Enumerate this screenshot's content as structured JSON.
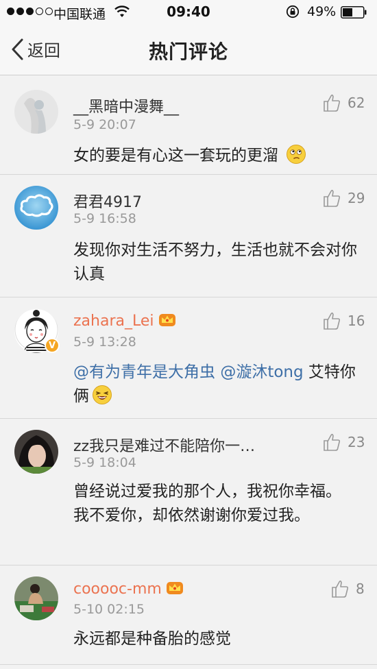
{
  "status_bar": {
    "carrier": "中国联通",
    "time": "09:40",
    "battery_percent": "49%",
    "battery_level": 0.49,
    "signal_bars_filled": 3,
    "signal_bars_total": 5
  },
  "nav": {
    "back_label": "返回",
    "title": "热门评论"
  },
  "colors": {
    "vip_name": "#eb7350",
    "mention": "#3e6fa7",
    "timestamp": "#999999",
    "verified": "#f5a623"
  },
  "comments": [
    {
      "username": "__黑暗中漫舞__",
      "vip": false,
      "verified": false,
      "time": "5-9 20:07",
      "likes": "62",
      "text": "女的要是有心这一套玩的更溜",
      "emoji": "thinking-emoji"
    },
    {
      "username": "君君4917",
      "vip": false,
      "verified": false,
      "time": "5-9 16:58",
      "likes": "29",
      "text": "发现你对生活不努力，生活也就不会对你认真",
      "emoji": null
    },
    {
      "username": "zahara_Lei",
      "vip": true,
      "verified": true,
      "verified_mark": "V",
      "time": "5-9 13:28",
      "likes": "16",
      "mention1": "@有为青年是大角虫",
      "mention2": "@漩沐tong",
      "text": "艾特你俩",
      "emoji": "laughing-emoji"
    },
    {
      "username": "zz我只是难过不能陪你一…",
      "vip": false,
      "verified": false,
      "time": "5-9 18:04",
      "likes": "23",
      "text": "曾经说过爱我的那个人，我祝你幸福。我不爱你，却依然谢谢你爱过我。",
      "emoji": null
    },
    {
      "username": "cooooc-mm",
      "vip": true,
      "verified": false,
      "time": "5-10 02:15",
      "likes": "8",
      "text": "永远都是种备胎的感觉",
      "emoji": null
    }
  ]
}
